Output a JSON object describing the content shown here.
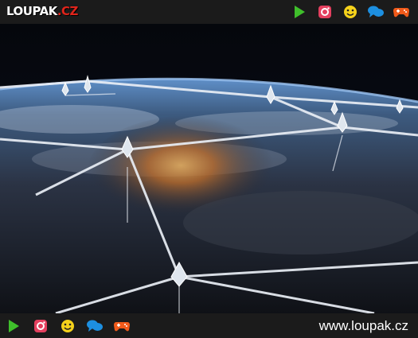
{
  "header": {
    "logo_main": "LOUPAK",
    "logo_tld": ".CZ",
    "icons": [
      "play-icon",
      "instagram-icon",
      "smiley-icon",
      "chat-icon",
      "gamepad-icon"
    ]
  },
  "photo": {
    "subject": "satellites-over-earth-image"
  },
  "footer": {
    "icons": [
      "play-icon",
      "instagram-icon",
      "smiley-icon",
      "chat-icon",
      "gamepad-icon"
    ],
    "site_url": "www.loupak.cz"
  },
  "colors": {
    "bar_bg": "#1b1b1b",
    "logo_accent": "#e0241b",
    "play": "#3fbf2b",
    "instagram": "#e4405f",
    "smiley": "#f5d21b",
    "chat": "#1d8fe0",
    "gamepad": "#f05a1a"
  }
}
